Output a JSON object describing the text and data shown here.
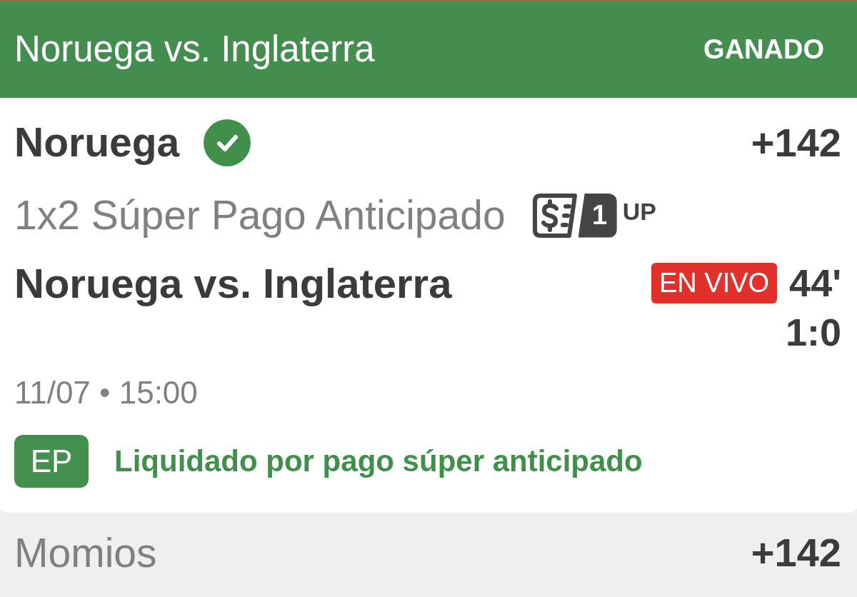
{
  "header": {
    "title": "Noruega vs. Inglaterra",
    "status": "GANADO"
  },
  "selection": {
    "pick": "Noruega",
    "won": true,
    "odds": "+142"
  },
  "market": {
    "name": "1x2 Súper Pago Anticipado",
    "boost": {
      "count": "1",
      "suffix": "UP"
    }
  },
  "event": {
    "name": "Noruega vs. Inglaterra",
    "live_label": "EN VIVO",
    "minute": "44'",
    "score": "1:0"
  },
  "datetime": "11/07 • 15:00",
  "settlement": {
    "badge": "EP",
    "text": "Liquidado por pago súper anticipado"
  },
  "footer": {
    "label": "Momios",
    "value": "+142"
  }
}
